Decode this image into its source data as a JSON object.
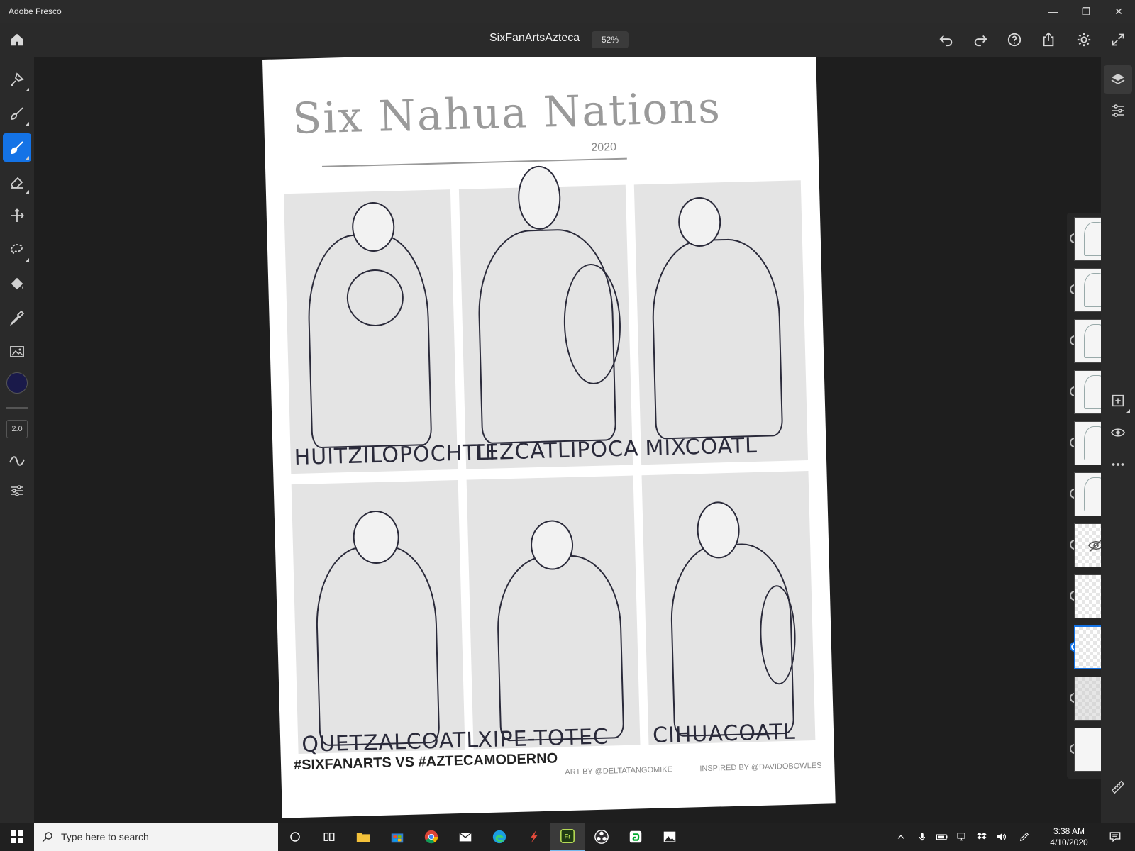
{
  "window": {
    "app_name": "Adobe Fresco",
    "minimize": "—",
    "maximize": "❐",
    "close": "✕"
  },
  "toolbar": {
    "document_title": "SixFanArtsAzteca",
    "zoom": "52%"
  },
  "left_tools": {
    "brush_size": "2.0",
    "current_color": "#1a1a4a"
  },
  "artwork": {
    "title": "Six Nahua Nations",
    "year": "2020",
    "names": [
      "HUITZILOPOCHTLI",
      "TEZCATLIPOCA",
      "MIXCOATL",
      "QUETZALCOATL",
      "XIPE-TOTEC",
      "CIHUACOATL"
    ],
    "hashtag": "#SIXFANARTS VS #AZTECAMODERNO",
    "art_by": "ART BY @DELTATANGOMIKE",
    "inspired_by": "INSPIRED BY @DAVIDOBOWLES"
  },
  "taskbar": {
    "search_placeholder": "Type here to search",
    "time": "3:38 AM",
    "date": "4/10/2020"
  },
  "colors": {
    "accent": "#1473e6",
    "chrome": "#2a2a2a",
    "canvas_bg": "#1e1e1e"
  }
}
